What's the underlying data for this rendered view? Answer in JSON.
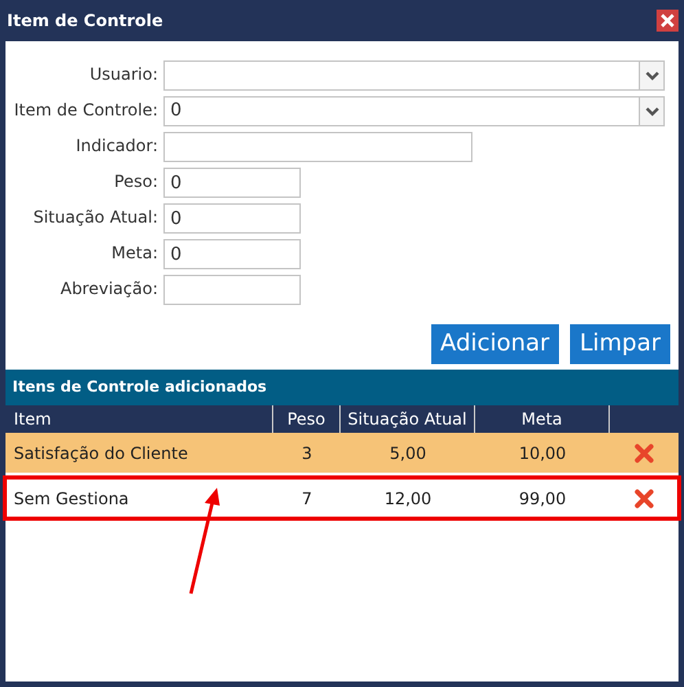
{
  "window": {
    "title": "Item de Controle"
  },
  "form": [
    {
      "label": "Usuario:",
      "kind": "select"
    },
    {
      "label": "Item de Controle:",
      "kind": "select",
      "value": "0"
    },
    {
      "label": "Indicador:",
      "kind": "wide"
    },
    {
      "label": "Peso:",
      "kind": "text",
      "value": "0"
    },
    {
      "label": "Situação Atual:",
      "kind": "text",
      "value": "0"
    },
    {
      "label": "Meta:",
      "kind": "text",
      "value": "0"
    },
    {
      "label": "Abreviação:",
      "kind": "text"
    }
  ],
  "buttons": [
    "Adicionar",
    "Limpar"
  ],
  "section": {
    "title": "Itens de Controle adicionados"
  },
  "table": {
    "columns": [
      "Item",
      "Peso",
      "Situação Atual",
      "Meta"
    ],
    "rows": [
      {
        "cells": [
          "Satisfação do Cliente",
          "3",
          "5,00",
          "10,00"
        ],
        "selected": true,
        "annotated": false
      },
      {
        "cells": [
          "Sem Gestiona",
          "7",
          "12,00",
          "99,00"
        ],
        "selected": false,
        "annotated": true
      }
    ]
  }
}
